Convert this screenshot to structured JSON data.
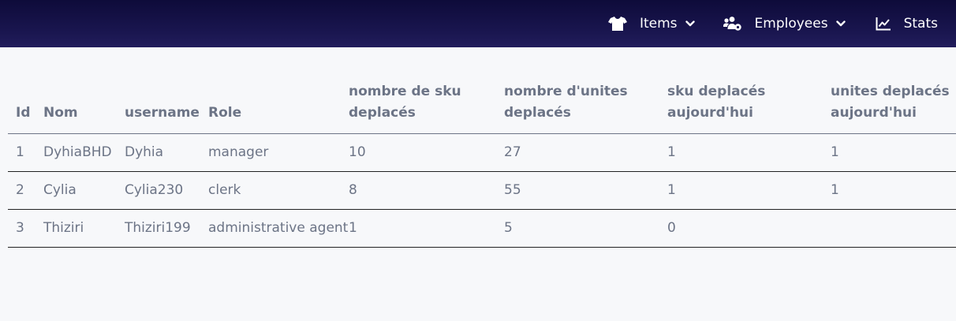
{
  "navbar": {
    "items": [
      {
        "label": "Items",
        "icon": "tshirt-icon",
        "has_dropdown": true
      },
      {
        "label": "Employees",
        "icon": "users-cog-icon",
        "has_dropdown": true
      },
      {
        "label": "Stats",
        "icon": "chart-line-icon",
        "has_dropdown": false
      }
    ]
  },
  "table": {
    "headers": {
      "id": "Id",
      "nom": "Nom",
      "username": "username",
      "role": "Role",
      "sku_moved": "nombre de sku deplacés",
      "units_moved": "nombre d'unites deplacés",
      "sku_today": "sku deplacés aujourd'hui",
      "units_today": "unites deplacés aujourd'hui"
    },
    "rows": [
      {
        "id": "1",
        "nom": "DyhiaBHD",
        "username": "Dyhia",
        "role": "manager",
        "sku_moved": "10",
        "units_moved": "27",
        "sku_today": "1",
        "units_today": "1"
      },
      {
        "id": "2",
        "nom": "Cylia",
        "username": "Cylia230",
        "role": "clerk",
        "sku_moved": "8",
        "units_moved": "55",
        "sku_today": "1",
        "units_today": "1"
      },
      {
        "id": "3",
        "nom": "Thiziri",
        "username": "Thiziri199",
        "role": "administrative agent",
        "sku_moved": "1",
        "units_moved": "5",
        "sku_today": "0",
        "units_today": ""
      }
    ]
  }
}
